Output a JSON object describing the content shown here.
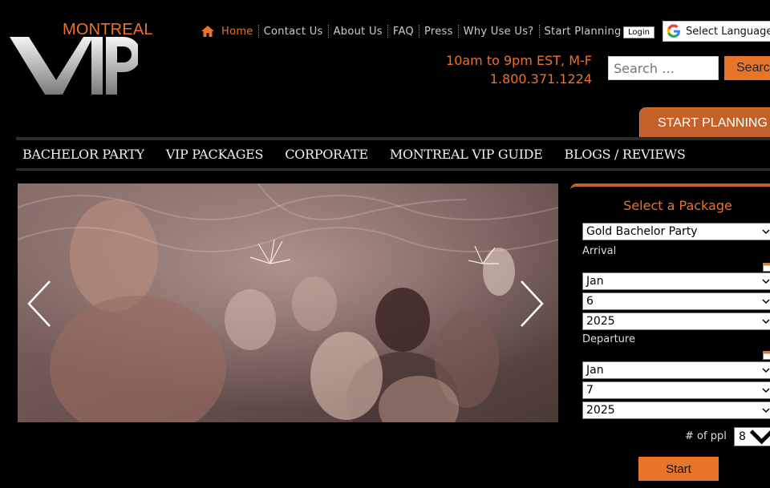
{
  "logo": {
    "city": "MONTREAL",
    "brand": "VIP"
  },
  "topnav": {
    "items": [
      {
        "label": "Home",
        "active": true
      },
      {
        "label": "Contact Us"
      },
      {
        "label": "About Us"
      },
      {
        "label": "FAQ"
      },
      {
        "label": "Press"
      },
      {
        "label": "Why Use Us?"
      },
      {
        "label": "Start Planning"
      }
    ],
    "login": "Login",
    "language": "Select Language"
  },
  "contact": {
    "hours": "10am to 9pm EST, M-F",
    "phone": "1.800.371.1224"
  },
  "search": {
    "placeholder": "Search …",
    "button": "Search"
  },
  "start_tab": "START PLANNING",
  "mainnav": [
    "BACHELOR PARTY",
    "VIP PACKAGES",
    "CORPORATE",
    "MONTREAL VIP GUIDE",
    "BLOGS / REVIEWS"
  ],
  "package_form": {
    "title": "Select a Package",
    "package": "Gold Bachelor Party",
    "arrival_label": "Arrival",
    "arrival": {
      "month": "Jan",
      "day": "6",
      "year": "2025"
    },
    "departure_label": "Departure",
    "departure": {
      "month": "Jan",
      "day": "7",
      "year": "2025"
    },
    "ppl_label": "# of ppl",
    "ppl": "8",
    "start": "Start"
  },
  "colors": {
    "accent": "#e8742a",
    "tab": "#c4612a",
    "background": "#000000"
  }
}
